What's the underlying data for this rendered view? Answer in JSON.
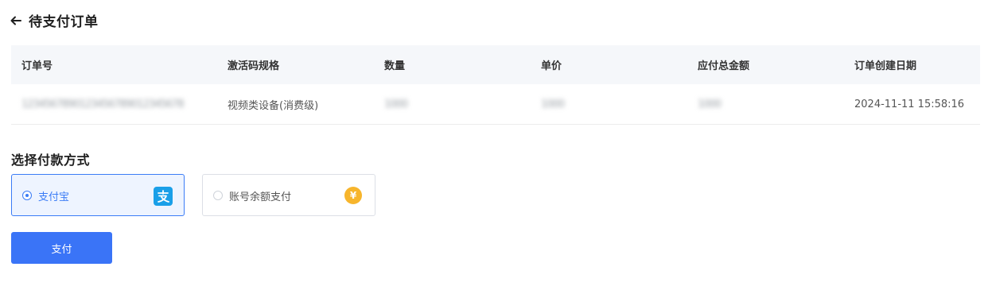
{
  "header": {
    "back_icon": "arrow-left-icon",
    "title": "待支付订单"
  },
  "table": {
    "columns": [
      "订单号",
      "激活码规格",
      "数量",
      "单价",
      "应付总金额",
      "订单创建日期"
    ],
    "rows": [
      {
        "order_no": "1234567890123456789012345678",
        "spec": "视频类设备(消费级)",
        "quantity": "1000",
        "unit_price": "1000",
        "total": "1000",
        "created": "2024-11-11 15:58:16"
      }
    ]
  },
  "payment": {
    "section_title": "选择付款方式",
    "methods": [
      {
        "label": "支付宝",
        "icon": "alipay-icon",
        "selected": true
      },
      {
        "label": "账号余额支付",
        "icon": "yuan-coin-icon",
        "selected": false
      }
    ],
    "coin_glyph": "¥",
    "submit_label": "支付"
  },
  "colors": {
    "accent": "#3a74f7",
    "header_bg": "#f5f7fa",
    "alipay": "#1a9fe8",
    "coin": "#f7b52c"
  }
}
